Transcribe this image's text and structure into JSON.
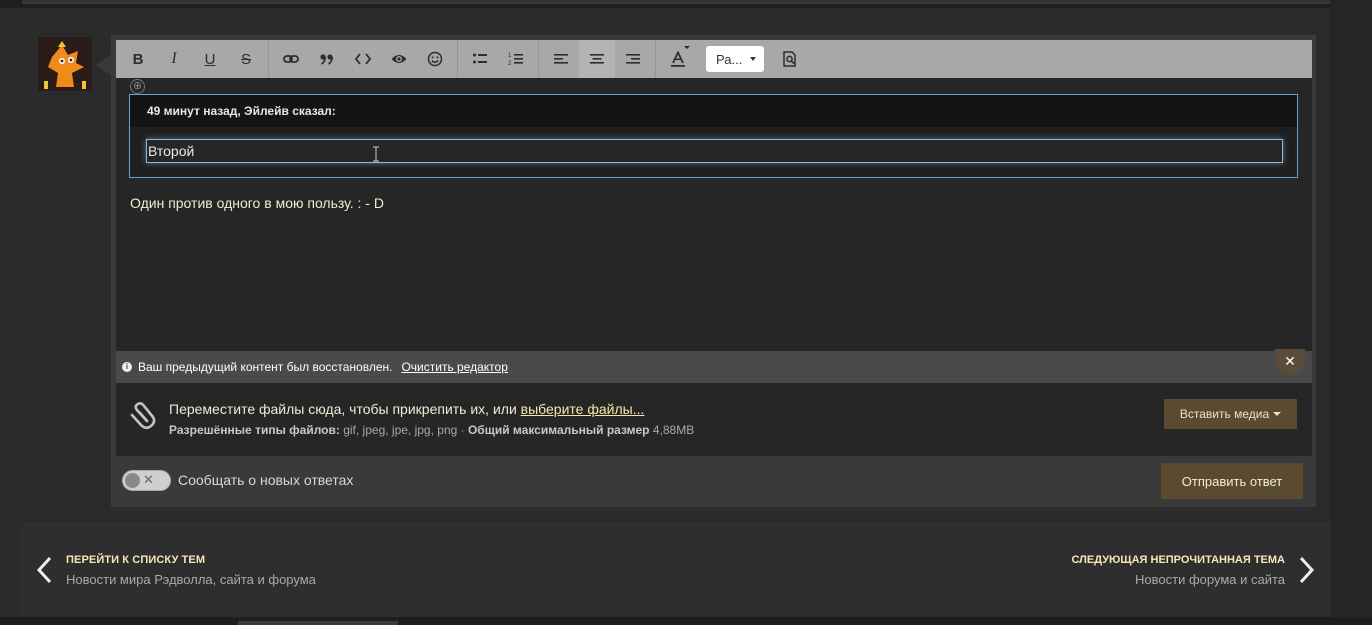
{
  "toolbar": {
    "buttons": [
      "B",
      "I",
      "U",
      "S"
    ],
    "font_select": "Ра..."
  },
  "editor": {
    "quote_handle": "⊕",
    "quote_author": "49 минут назад, Эйлейв сказал:",
    "quote_text": "Второй",
    "message": "Один против одного в мою пользу. : - D"
  },
  "restore": {
    "info_icon": "i",
    "text": "Ваш предыдущий контент был восстановлен.",
    "clear_link": "Очистить редактор",
    "close": "✕"
  },
  "attach": {
    "text": "Переместите файлы сюда, чтобы прикрепить их, или ",
    "pick_link": "выберите файлы...",
    "types_label": "Разрешённые типы файлов:",
    "types_value": " gif, jpeg, jpe, jpg, png · ",
    "max_label": "Общий максимальный размер",
    "max_value": " 4,88MB",
    "media_button": "Вставить медиа"
  },
  "footer": {
    "toggle_x": "✕",
    "notify_label": "Сообщать о новых ответах",
    "send_button": "Отправить ответ"
  },
  "nav": {
    "left_title": "ПЕРЕЙТИ К СПИСКУ ТЕМ",
    "left_sub": "Новости мира Рэдволла, сайта и форума",
    "right_title": "СЛЕДУЮЩАЯ НЕПРОЧИТАННАЯ ТЕМА",
    "right_sub": "Новости форума и сайта"
  },
  "colors": {
    "accent_button": "#5a4b30",
    "quote_border": "#5fa3d8",
    "link_highlight": "#f6e7a8"
  }
}
